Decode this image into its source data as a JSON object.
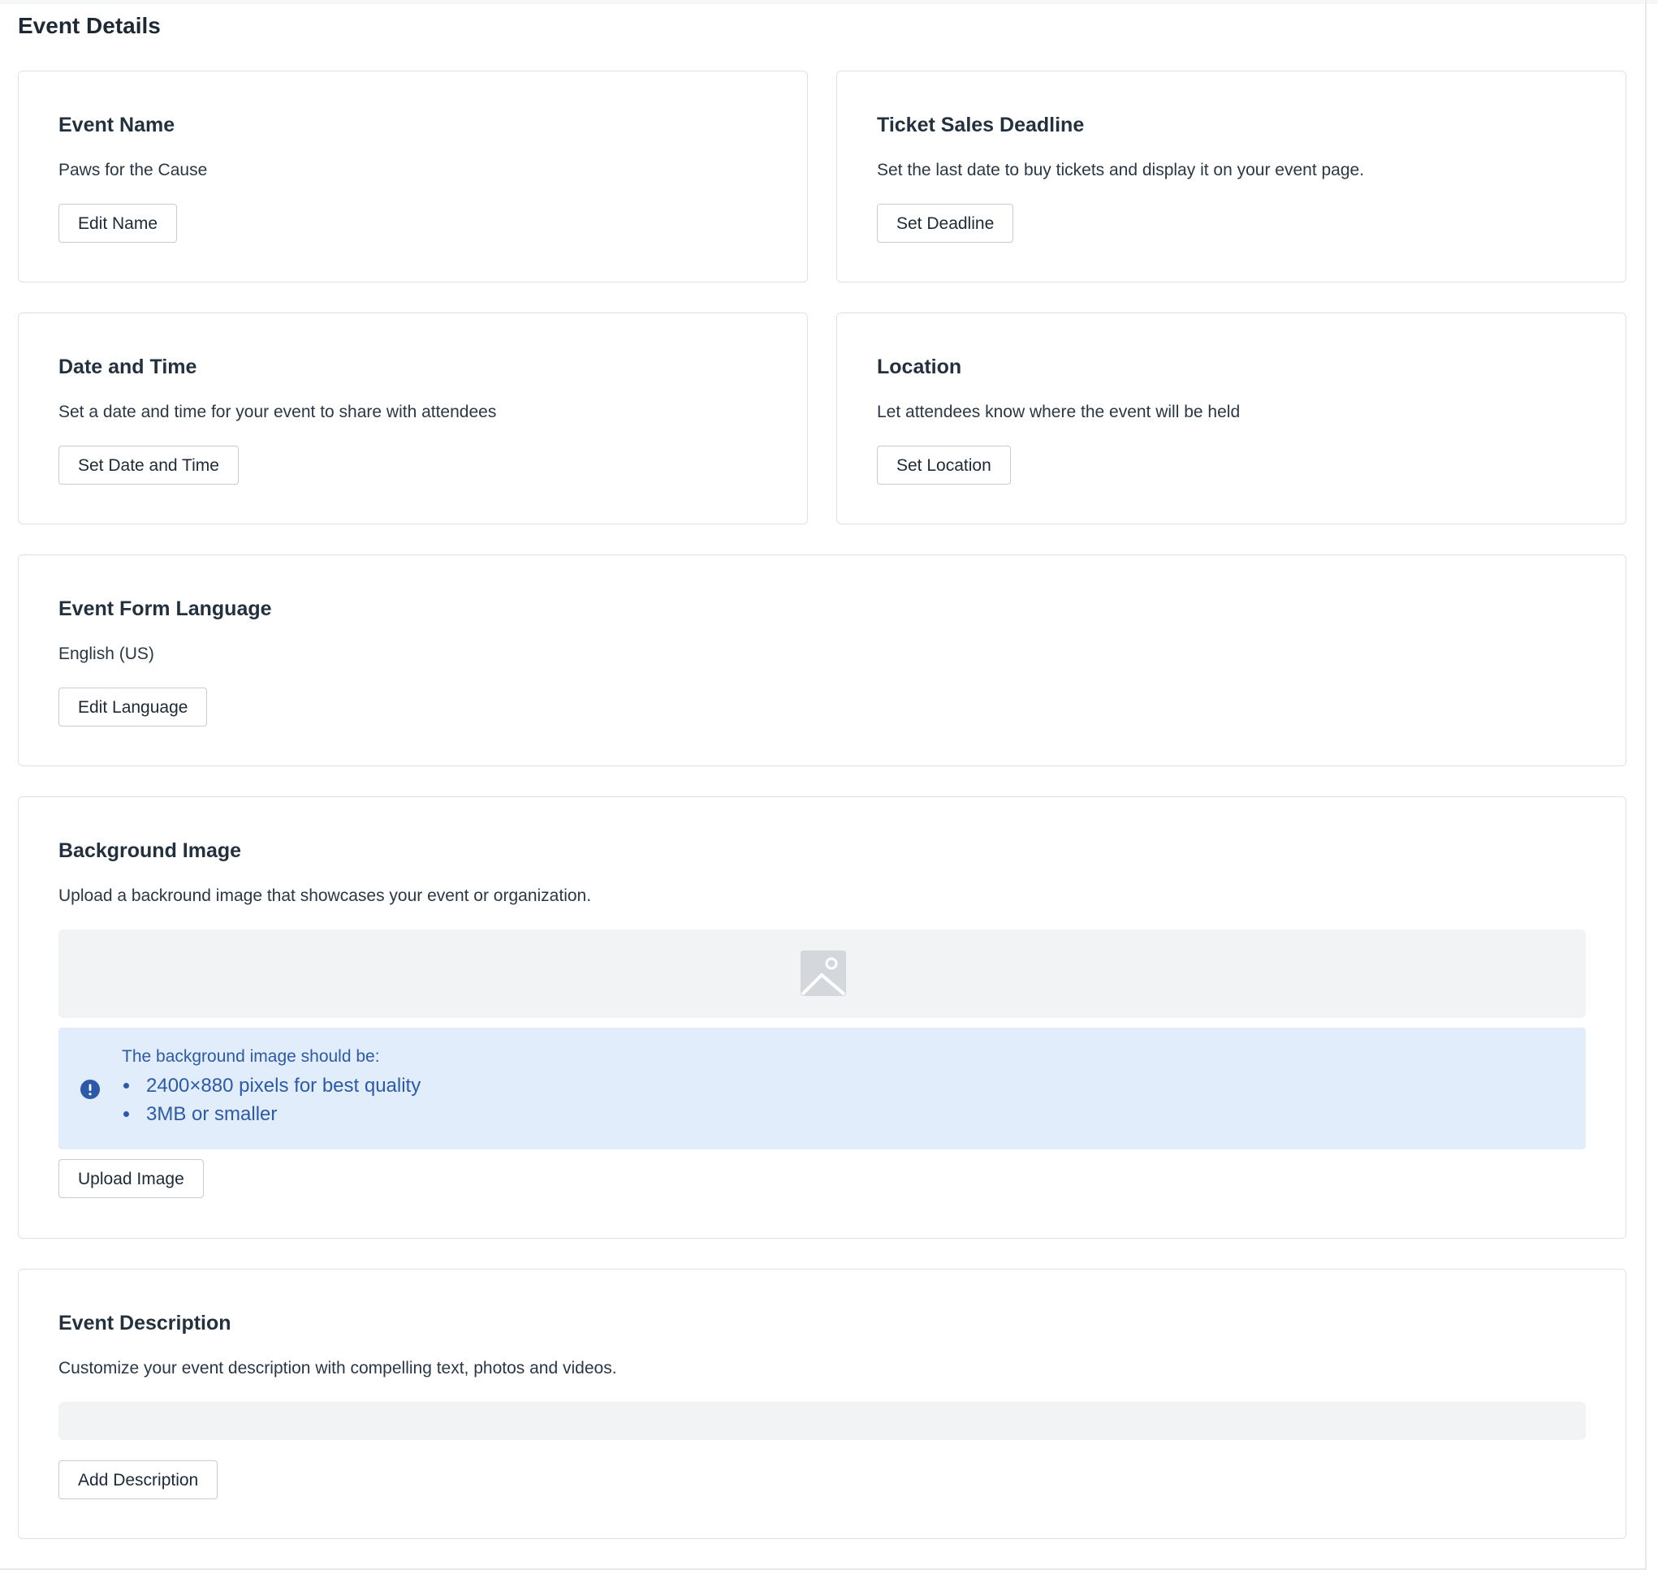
{
  "page": {
    "title": "Event Details"
  },
  "cards": {
    "event_name": {
      "title": "Event Name",
      "value": "Paws for the Cause",
      "button_label": "Edit Name"
    },
    "ticket_deadline": {
      "title": "Ticket Sales Deadline",
      "description": "Set the last date to buy tickets and display it on your event page.",
      "button_label": "Set Deadline"
    },
    "date_time": {
      "title": "Date and Time",
      "description": "Set a date and time for your event to share with attendees",
      "button_label": "Set Date and Time"
    },
    "location": {
      "title": "Location",
      "description": "Let attendees know where the event will be held",
      "button_label": "Set Location"
    },
    "form_language": {
      "title": "Event Form Language",
      "value": "English (US)",
      "button_label": "Edit Language"
    },
    "background_image": {
      "title": "Background Image",
      "description": "Upload a backround image that showcases your event or organization.",
      "placeholder_icon": "image-placeholder-icon",
      "info": {
        "icon": "info-icon",
        "heading": "The background image should be:",
        "requirements": [
          "2400×880 pixels for best quality",
          "3MB or smaller"
        ]
      },
      "button_label": "Upload Image"
    },
    "event_description": {
      "title": "Event Description",
      "description": "Customize your event description with compelling text, photos and videos.",
      "button_label": "Add Description"
    }
  },
  "colors": {
    "text": "#1f2d3d",
    "border": "#dde1e6",
    "placeholder_bg": "#f2f3f5",
    "info_bg": "#e1edfb",
    "info_text": "#2c5aa8"
  }
}
